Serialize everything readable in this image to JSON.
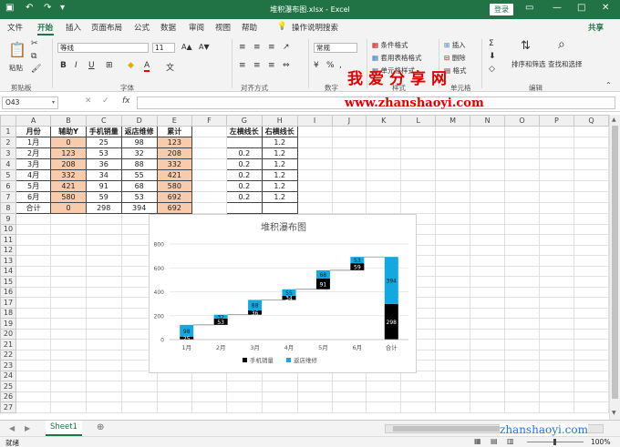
{
  "window": {
    "title": "堆积瀑布图.xlsx - Excel",
    "login": "登录"
  },
  "tabs": [
    "文件",
    "开始",
    "插入",
    "页面布局",
    "公式",
    "数据",
    "审阅",
    "视图",
    "帮助"
  ],
  "tell_me": "操作说明搜索",
  "share": "共享",
  "ribbon": {
    "font_name": "等线",
    "font_size": "11",
    "number_format": "常规",
    "paste": "粘贴",
    "groups": [
      "剪贴板",
      "字体",
      "对齐方式",
      "数字",
      "样式",
      "单元格",
      "编辑"
    ],
    "styles": [
      "条件格式",
      "套用表格格式",
      "单元格样式"
    ],
    "cells": [
      "插入",
      "删除",
      "格式"
    ],
    "edit": [
      "排序和筛选",
      "查找和选择"
    ]
  },
  "formula_bar": {
    "name_box": "O43",
    "fx": "fx",
    "value": ""
  },
  "columns": [
    "A",
    "B",
    "C",
    "D",
    "E",
    "F",
    "G",
    "H",
    "I",
    "J",
    "K",
    "L",
    "M",
    "N",
    "O",
    "P",
    "Q"
  ],
  "rows": [
    "1",
    "2",
    "3",
    "4",
    "5",
    "6",
    "7",
    "8",
    "9",
    "10",
    "11",
    "12",
    "13",
    "14",
    "15",
    "16",
    "17",
    "18",
    "19",
    "20",
    "21",
    "22",
    "23",
    "24",
    "25",
    "26",
    "27"
  ],
  "table": {
    "headers": [
      "月份",
      "辅助Y",
      "手机销量",
      "返店维修",
      "累计"
    ],
    "data": [
      [
        "1月",
        "0",
        "25",
        "98",
        "123"
      ],
      [
        "2月",
        "123",
        "53",
        "32",
        "208"
      ],
      [
        "3月",
        "208",
        "36",
        "88",
        "332"
      ],
      [
        "4月",
        "332",
        "34",
        "55",
        "421"
      ],
      [
        "5月",
        "421",
        "91",
        "68",
        "580"
      ],
      [
        "6月",
        "580",
        "59",
        "53",
        "692"
      ],
      [
        "合计",
        "0",
        "298",
        "394",
        "692"
      ]
    ]
  },
  "table2": {
    "headers": [
      "左横线长",
      "右横线长"
    ],
    "data": [
      [
        "",
        "1.2"
      ],
      [
        "0.2",
        "1.2"
      ],
      [
        "0.2",
        "1.2"
      ],
      [
        "0.2",
        "1.2"
      ],
      [
        "0.2",
        "1.2"
      ],
      [
        "0.2",
        "1.2"
      ],
      [
        "",
        ""
      ]
    ]
  },
  "chart_data": {
    "type": "bar",
    "title": "堆积瀑布图",
    "categories": [
      "1月",
      "2月",
      "3月",
      "4月",
      "5月",
      "6月",
      "合计"
    ],
    "series": [
      {
        "name": "辅助Y",
        "values": [
          0,
          123,
          208,
          332,
          421,
          580,
          0
        ]
      },
      {
        "name": "手机销量",
        "values": [
          25,
          53,
          36,
          34,
          91,
          59,
          298
        ]
      },
      {
        "name": "返店维修",
        "values": [
          98,
          32,
          88,
          55,
          68,
          53,
          394
        ]
      }
    ],
    "ylim": [
      0,
      800
    ],
    "yticks": [
      "0",
      "200",
      "400",
      "600",
      "800"
    ],
    "legend": [
      "手机销量",
      "返店维修"
    ],
    "legend_position": "bottom",
    "colors": {
      "手机销量": "#000000",
      "返店维修": "#12a8e0"
    }
  },
  "sheet_tab": "Sheet1",
  "status": {
    "left": "就绪",
    "zoom": "100%"
  },
  "watermark": {
    "line1": "我爱分享网",
    "line2": "www.zhanshaoyi.com",
    "line3": "zhanshaoyi.com"
  }
}
